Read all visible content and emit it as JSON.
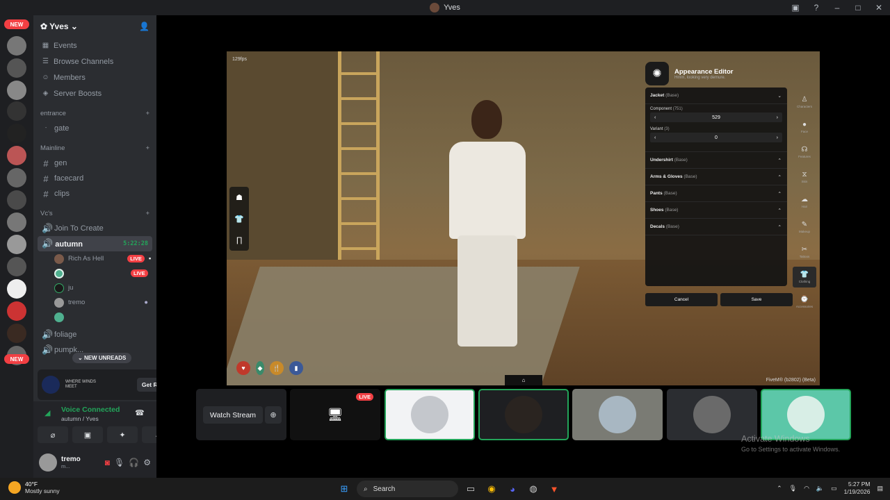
{
  "window": {
    "title": "Yves"
  },
  "servers": {
    "new_badge_top": "NEW",
    "new_badge_bottom": "NEW"
  },
  "guild": {
    "name": "Yves",
    "nav": [
      "Events",
      "Browse Channels",
      "Members",
      "Server Boosts"
    ],
    "categories": {
      "entrance": "entrance",
      "mainline": "Mainline",
      "vcs": "Vc's"
    },
    "channels": {
      "gate": "gate",
      "gen": "gen",
      "facecard": "facecard",
      "clips": "clips",
      "join_to_create": "Join To Create",
      "autumn": "autumn",
      "autumn_timer": "5:22:28",
      "foliage": "foliage",
      "pumpkin": "pumpk..."
    },
    "voice_users": {
      "u1": "Rich As Hell",
      "u3": "ju",
      "u4": "tremo"
    },
    "live_label": "LIVE",
    "new_unreads": "NEW UNREADS"
  },
  "promo": {
    "brand": "WHERE WINDS MEET",
    "button": "Get Reward!"
  },
  "voice": {
    "status": "Voice Connected",
    "location": "autumn / Yves"
  },
  "user": {
    "name": "tremo",
    "status": "m..."
  },
  "game": {
    "fps": "129fps",
    "build": "FiveM® (b2802) (Beta)",
    "editor": {
      "title": "Appearance Editor",
      "subtitle": "Hmm, looking very demure.",
      "jacket": "Jacket",
      "jacket_base": "(Base)",
      "component_label": "Component",
      "component_count": "(751)",
      "component_value": "529",
      "variant_label": "Variant",
      "variant_count": "(3)",
      "variant_value": "0",
      "sections": [
        {
          "name": "Undershirt",
          "base": "(Base)"
        },
        {
          "name": "Arms & Gloves",
          "base": "(Base)"
        },
        {
          "name": "Pants",
          "base": "(Base)"
        },
        {
          "name": "Shoes",
          "base": "(Base)"
        },
        {
          "name": "Decals",
          "base": "(Base)"
        }
      ],
      "cancel": "Cancel",
      "save": "Save",
      "tabs": [
        "Characters",
        "Face",
        "Features",
        "Skin",
        "Hair",
        "Makeup",
        "Tattoos",
        "Clothing",
        "Accessories"
      ]
    }
  },
  "streams": {
    "watch": "Watch Stream",
    "live": "LIVE"
  },
  "activation": {
    "title": "Activate Windows",
    "sub": "Go to Settings to activate Windows."
  },
  "taskbar": {
    "temp": "40°F",
    "weather": "Mostly sunny",
    "search": "Search",
    "time": "5:27 PM",
    "date": "1/19/2026"
  }
}
